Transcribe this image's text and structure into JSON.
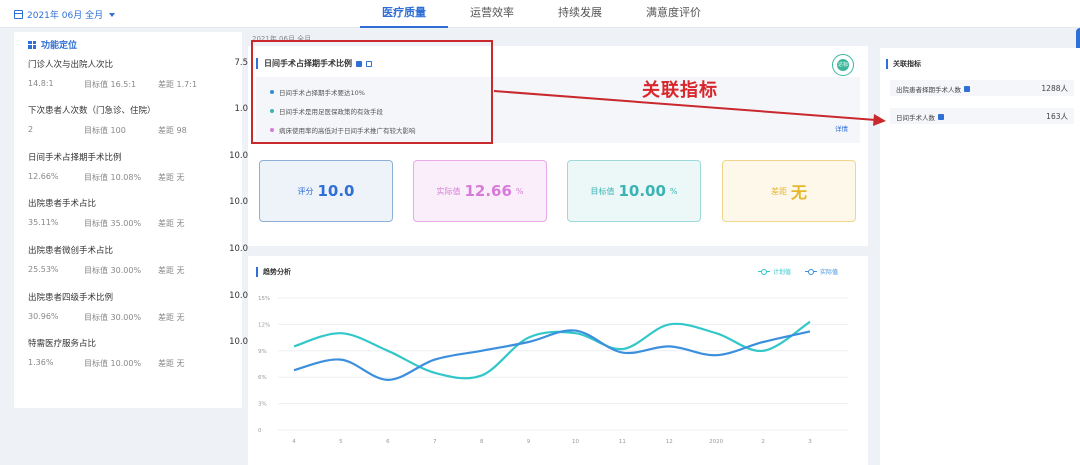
{
  "topbar": {
    "date_label": "2021年 06月 全月",
    "tabs": [
      {
        "label": "医疗质量",
        "active": true
      },
      {
        "label": "运营效率",
        "active": false
      },
      {
        "label": "持续发展",
        "active": false
      },
      {
        "label": "满意度评价",
        "active": false
      }
    ]
  },
  "sidebar": {
    "title": "功能定位",
    "items": [
      {
        "name": "门诊人次与出院人次比",
        "score": "7.5",
        "value": "14.8:1",
        "target": "目标值 16.5:1",
        "gap": "差距 1.7:1"
      },
      {
        "name": "下次患者人次数（门急诊、住院）",
        "score": "1.0",
        "value": "2",
        "target": "目标值 100",
        "gap": "差距 98"
      },
      {
        "name": "日间手术占择期手术比例",
        "score": "10.0",
        "value": "12.66%",
        "target": "目标值 10.08%",
        "gap": "差距 无"
      },
      {
        "name": "出院患者手术占比",
        "score": "10.0",
        "value": "35.11%",
        "target": "目标值 35.00%",
        "gap": "差距 无"
      },
      {
        "name": "出院患者微创手术占比",
        "score": "10.0",
        "value": "25.53%",
        "target": "目标值 30.00%",
        "gap": "差距 无"
      },
      {
        "name": "出院患者四级手术比例",
        "score": "10.0",
        "value": "30.96%",
        "target": "目标值 30.00%",
        "gap": "差距 无"
      },
      {
        "name": "特需医疗服务占比",
        "score": "10.0",
        "value": "1.36%",
        "target": "目标值 10.00%",
        "gap": "差距 无"
      }
    ]
  },
  "main": {
    "faint_title": "2021年 06月 全月",
    "card_title": "日间手术占择期手术比例",
    "badge": "达标",
    "descriptions": [
      {
        "text": "日间手术占择期手术要达10%",
        "color": "#2f8fd6"
      },
      {
        "text": "日间手术是用足医保政策的有效手段",
        "color": "#3bb3b5"
      },
      {
        "text": "病床使用率的高低对于日间手术推广有较大影响",
        "color": "#d77bd9"
      }
    ],
    "detail_link": "详情",
    "metrics": [
      {
        "label": "评分",
        "value": "10.0",
        "unit": ""
      },
      {
        "label": "实际值",
        "value": "12.66",
        "unit": "%"
      },
      {
        "label": "目标值",
        "value": "10.00",
        "unit": "%"
      },
      {
        "label": "差距",
        "value": "无",
        "unit": ""
      }
    ]
  },
  "annotation": {
    "label": "关联指标",
    "color": "#d8262c"
  },
  "related": {
    "title": "关联指标",
    "items": [
      {
        "name": "出院患者择期手术人数",
        "count": "1288人"
      },
      {
        "name": "日间手术人数",
        "count": "163人"
      }
    ]
  },
  "chart_data": {
    "type": "line",
    "title": "趋势分析",
    "x": [
      "4",
      "5",
      "6",
      "7",
      "8",
      "9",
      "10",
      "11",
      "12",
      "2020",
      "2",
      "3"
    ],
    "y_ticks": [
      "0",
      "3%",
      "6%",
      "9%",
      "12%",
      "15%"
    ],
    "ylim": [
      0,
      15
    ],
    "grid": true,
    "legend_position": "top-right",
    "series": [
      {
        "name": "计划值",
        "color": "#33c7c9",
        "values": [
          9.5,
          11.0,
          9.0,
          6.5,
          6.2,
          10.5,
          11.0,
          9.2,
          12.0,
          11.0,
          9.0,
          12.3
        ]
      },
      {
        "name": "实际值",
        "color": "#3b8fdc",
        "values": [
          6.8,
          8.0,
          5.7,
          8.0,
          9.0,
          10.0,
          11.3,
          8.8,
          9.5,
          8.5,
          10.0,
          11.2
        ]
      }
    ]
  }
}
